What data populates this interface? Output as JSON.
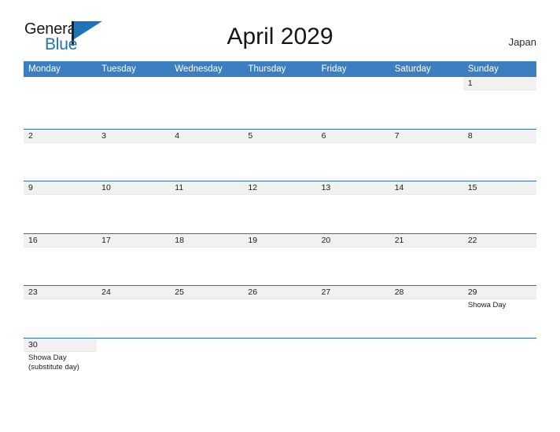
{
  "brand": {
    "name_part1": "General",
    "name_part2": "Blue",
    "mark": "flag-triangle"
  },
  "header": {
    "title": "April 2029",
    "region": "Japan"
  },
  "colors": {
    "header_blue": "#3c7ebf",
    "row_rule_blue": "#2f6fb0",
    "date_band_gray": "#f1f1f1",
    "brand_blue": "#1f73b7"
  },
  "weekdays": [
    "Monday",
    "Tuesday",
    "Wednesday",
    "Thursday",
    "Friday",
    "Saturday",
    "Sunday"
  ],
  "weeks": [
    {
      "days": [
        {
          "num": "",
          "events": []
        },
        {
          "num": "",
          "events": []
        },
        {
          "num": "",
          "events": []
        },
        {
          "num": "",
          "events": []
        },
        {
          "num": "",
          "events": []
        },
        {
          "num": "",
          "events": []
        },
        {
          "num": "1",
          "events": []
        }
      ]
    },
    {
      "days": [
        {
          "num": "2",
          "events": []
        },
        {
          "num": "3",
          "events": []
        },
        {
          "num": "4",
          "events": []
        },
        {
          "num": "5",
          "events": []
        },
        {
          "num": "6",
          "events": []
        },
        {
          "num": "7",
          "events": []
        },
        {
          "num": "8",
          "events": []
        }
      ]
    },
    {
      "days": [
        {
          "num": "9",
          "events": []
        },
        {
          "num": "10",
          "events": []
        },
        {
          "num": "11",
          "events": []
        },
        {
          "num": "12",
          "events": []
        },
        {
          "num": "13",
          "events": []
        },
        {
          "num": "14",
          "events": []
        },
        {
          "num": "15",
          "events": []
        }
      ]
    },
    {
      "days": [
        {
          "num": "16",
          "events": []
        },
        {
          "num": "17",
          "events": []
        },
        {
          "num": "18",
          "events": []
        },
        {
          "num": "19",
          "events": []
        },
        {
          "num": "20",
          "events": []
        },
        {
          "num": "21",
          "events": []
        },
        {
          "num": "22",
          "events": []
        }
      ]
    },
    {
      "days": [
        {
          "num": "23",
          "events": []
        },
        {
          "num": "24",
          "events": []
        },
        {
          "num": "25",
          "events": []
        },
        {
          "num": "26",
          "events": []
        },
        {
          "num": "27",
          "events": []
        },
        {
          "num": "28",
          "events": []
        },
        {
          "num": "29",
          "events": [
            "Showa Day"
          ]
        }
      ]
    },
    {
      "days": [
        {
          "num": "30",
          "events": [
            "Showa Day",
            "(substitute day)"
          ]
        },
        {
          "num": "",
          "events": []
        },
        {
          "num": "",
          "events": []
        },
        {
          "num": "",
          "events": []
        },
        {
          "num": "",
          "events": []
        },
        {
          "num": "",
          "events": []
        },
        {
          "num": "",
          "events": []
        }
      ]
    }
  ]
}
